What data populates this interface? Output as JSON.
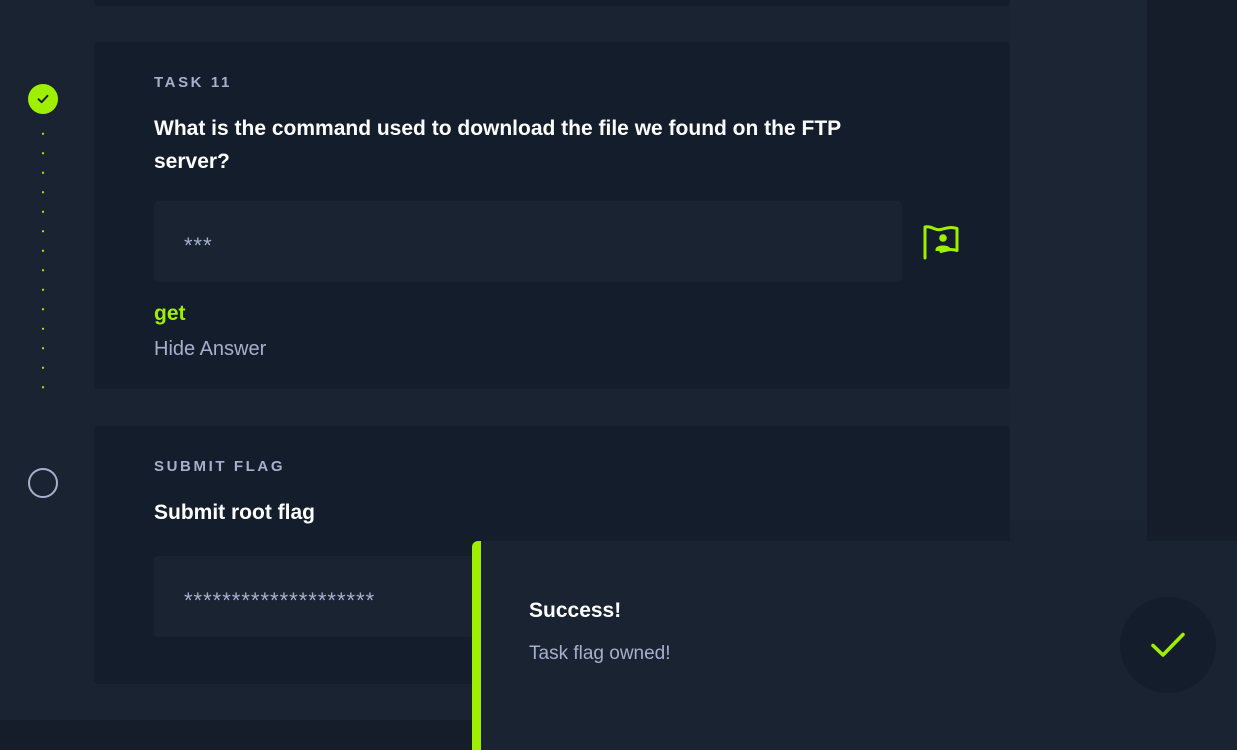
{
  "task11": {
    "kicker": "TASK 11",
    "question": "What is the command used to download the file we found on the FTP server?",
    "answer_mask": "***",
    "answer": "get",
    "hide_label": "Hide Answer"
  },
  "submit_flag": {
    "kicker": "SUBMIT FLAG",
    "question": "Submit root flag",
    "answer_mask": "********************"
  },
  "toast": {
    "title": "Success!",
    "message": "Task flag owned!"
  },
  "icons": {
    "step_done": "check-icon",
    "step_open": "circle-outline-icon",
    "flag_button": "flag-user-icon",
    "toast": "check-icon"
  },
  "colors": {
    "accent": "#9fef00",
    "background": "#1a2332",
    "card": "#141d2b",
    "muted_text": "#a4b1cd",
    "text": "#ffffff"
  }
}
